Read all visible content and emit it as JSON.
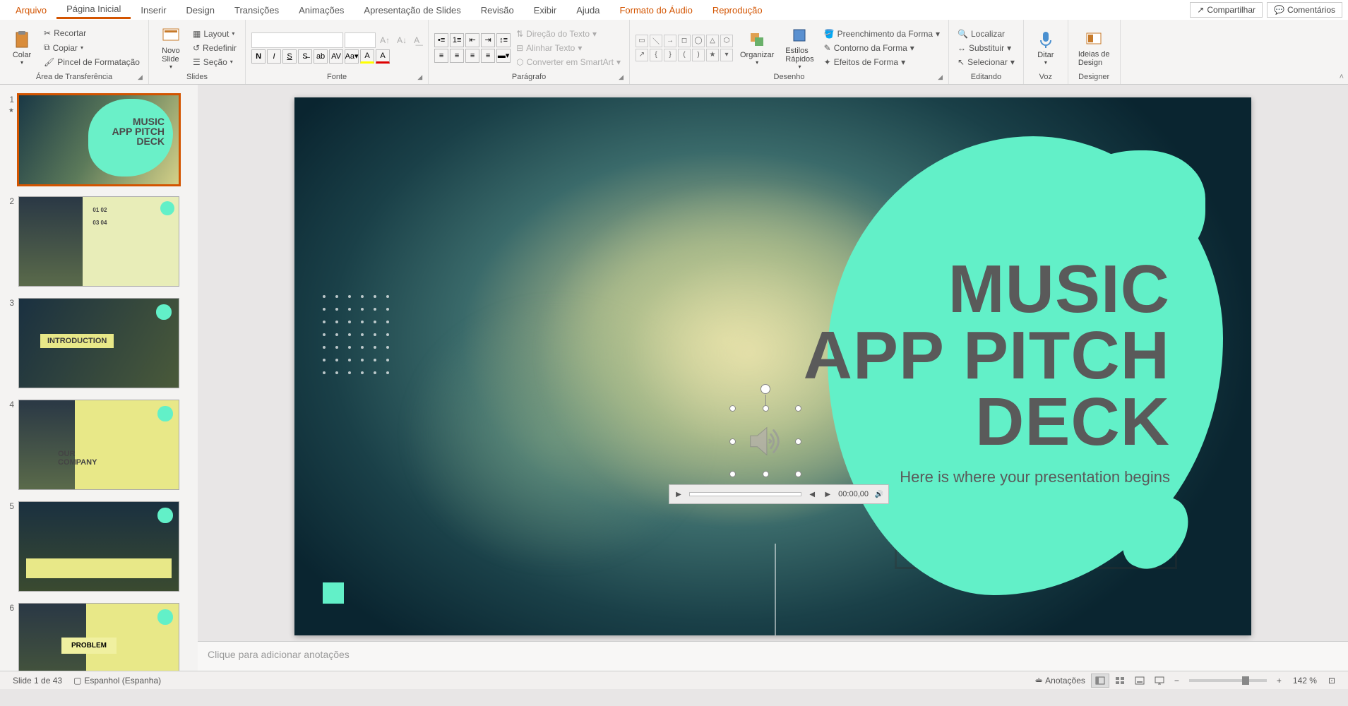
{
  "menubar": {
    "file": "Arquivo",
    "tabs": [
      "Página Inicial",
      "Inserir",
      "Design",
      "Transições",
      "Animações",
      "Apresentação de Slides",
      "Revisão",
      "Exibir",
      "Ajuda"
    ],
    "contextual": [
      "Formato do Áudio",
      "Reprodução"
    ],
    "share": "Compartilhar",
    "comments": "Comentários"
  },
  "ribbon": {
    "clipboard": {
      "label": "Área de Transferência",
      "paste": "Colar",
      "cut": "Recortar",
      "copy": "Copiar",
      "painter": "Pincel de Formatação"
    },
    "slides": {
      "label": "Slides",
      "new_slide": "Novo\nSlide",
      "layout": "Layout",
      "reset": "Redefinir",
      "section": "Seção"
    },
    "font": {
      "label": "Fonte"
    },
    "paragraph": {
      "label": "Parágrafo",
      "direction": "Direção do Texto",
      "align": "Alinhar Texto",
      "smartart": "Converter em SmartArt"
    },
    "drawing": {
      "label": "Desenho",
      "arrange": "Organizar",
      "styles": "Estilos\nRápidos",
      "fill": "Preenchimento da Forma",
      "outline": "Contorno da Forma",
      "effects": "Efeitos de Forma"
    },
    "editing": {
      "label": "Editando",
      "find": "Localizar",
      "replace": "Substituir",
      "select": "Selecionar"
    },
    "voice": {
      "label": "Voz",
      "dictate": "Ditar"
    },
    "designer": {
      "label": "Designer",
      "ideas": "Ideias de\nDesign"
    }
  },
  "slide": {
    "title_l1": "MUSIC",
    "title_l2": "APP PITCH",
    "title_l3": "DECK",
    "subtitle": "Here is where your presentation begins"
  },
  "thumbs": {
    "t1": {
      "l1": "MUSIC",
      "l2": "APP PITCH",
      "l3": "DECK"
    },
    "t2": {
      "n1": "01",
      "n2": "02",
      "n3": "03",
      "n4": "04"
    },
    "t3": "INTRODUCTION",
    "t4": "OUR\nCOMPANY",
    "t6": "PROBLEM"
  },
  "audio": {
    "time": "00:00,00"
  },
  "notes": {
    "placeholder": "Clique para adicionar anotações"
  },
  "status": {
    "slide": "Slide 1 de 43",
    "lang": "Espanhol (Espanha)",
    "notes": "Anotações",
    "zoom": "142 %"
  }
}
